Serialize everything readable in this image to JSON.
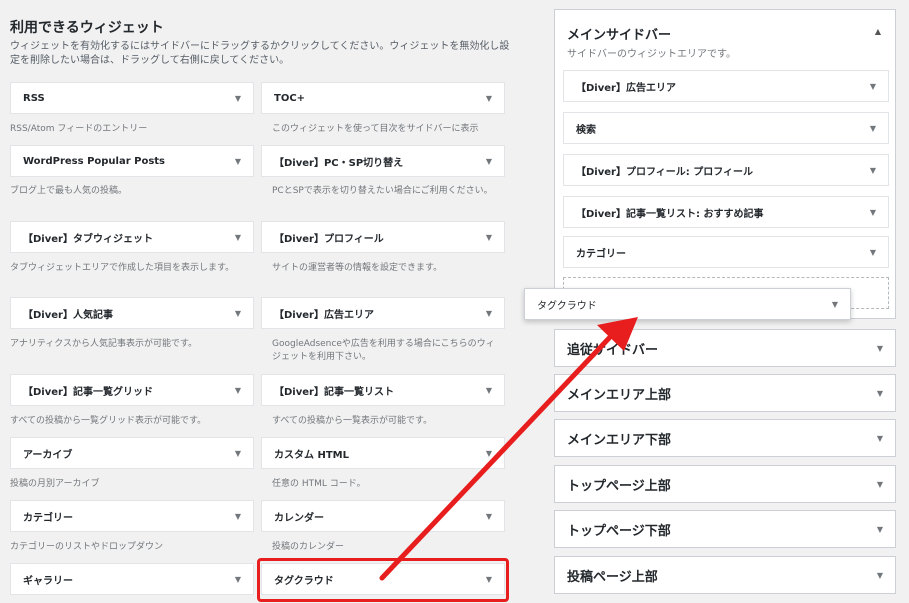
{
  "available": {
    "heading": "利用できるウィジェット",
    "description": "ウィジェットを有効化するにはサイドバーにドラッグするかクリックしてください。ウィジェットを無効化し設定を削除したい場合は、ドラッグして右側に戻してください。",
    "widgets": [
      {
        "title": "RSS",
        "desc": "RSS/Atom フィードのエントリー"
      },
      {
        "title": "TOC+",
        "desc": "このウィジェットを使って目次をサイドバーに表示"
      },
      {
        "title": "WordPress Popular Posts",
        "desc": "ブログ上で最も人気の投稿。"
      },
      {
        "title": "【Diver】PC・SP切り替え",
        "desc": "PCとSPで表示を切り替えたい場合にご利用ください。"
      },
      {
        "title": "【Diver】タブウィジェット",
        "desc": "タブウィジェットエリアで作成した項目を表示します。"
      },
      {
        "title": "【Diver】プロフィール",
        "desc": "サイトの運営者等の情報を設定できます。"
      },
      {
        "title": "【Diver】人気記事",
        "desc": "アナリティクスから人気記事表示が可能です。"
      },
      {
        "title": "【Diver】広告エリア",
        "desc": "GoogleAdsenceや広告を利用する場合にこちらのウィジェットを利用下さい。"
      },
      {
        "title": "【Diver】記事一覧グリッド",
        "desc": "すべての投稿から一覧グリッド表示が可能です。"
      },
      {
        "title": "【Diver】記事一覧リスト",
        "desc": "すべての投稿から一覧表示が可能です。"
      },
      {
        "title": "アーカイブ",
        "desc": "投稿の月別アーカイブ"
      },
      {
        "title": "カスタム HTML",
        "desc": "任意の HTML コード。"
      },
      {
        "title": "カテゴリー",
        "desc": "カテゴリーのリストやドロップダウン"
      },
      {
        "title": "カレンダー",
        "desc": "投稿のカレンダー"
      },
      {
        "title": "ギャラリー",
        "desc": ""
      },
      {
        "title": "タグクラウド",
        "desc": ""
      }
    ]
  },
  "main_sidebar": {
    "title": "メインサイドバー",
    "description": "サイドバーのウィジットエリアです。",
    "widgets": [
      "【Diver】広告エリア",
      "検索",
      "【Diver】プロフィール: プロフィール",
      "【Diver】記事一覧リスト: おすすめ記事",
      "カテゴリー"
    ]
  },
  "dragging_widget": "タグクラウド",
  "other_sidebars": [
    "追従サイドバー",
    "メインエリア上部",
    "メインエリア下部",
    "トップページ上部",
    "トップページ下部",
    "投稿ページ上部"
  ],
  "icons": {
    "expand": "▼",
    "collapse": "▲"
  },
  "colors": {
    "highlight": "#e81e1e",
    "background": "#f1f1f1"
  }
}
